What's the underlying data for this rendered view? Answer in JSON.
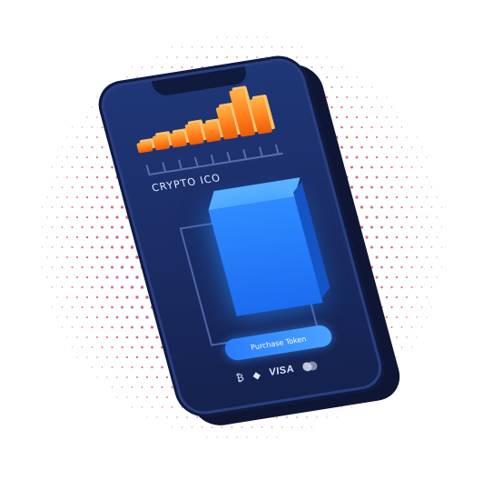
{
  "app": {
    "title": "CRYPTO ICO",
    "bars": [
      0.22,
      0.3,
      0.3,
      0.45,
      0.4,
      0.7,
      1.0,
      0.75
    ],
    "purchase_label": "Purchase Token",
    "payment_methods": [
      {
        "icon": "bitcoin-icon",
        "glyph": "₿"
      },
      {
        "icon": "ethereum-icon",
        "glyph": "◆"
      },
      {
        "icon": "visa-icon",
        "text": "VISA"
      },
      {
        "icon": "mastercard-icon"
      }
    ]
  },
  "colors": {
    "accent": "#2a7dff",
    "bars": "#ff7a1a",
    "dots": "#d0104c",
    "phone": "#1f3778"
  }
}
